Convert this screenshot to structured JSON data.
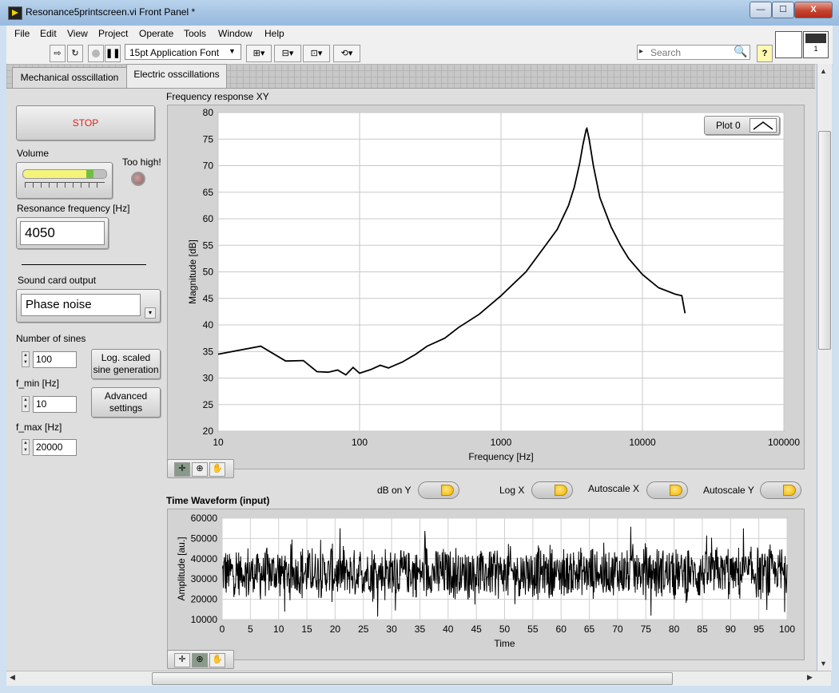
{
  "window": {
    "title": "Resonance5printscreen.vi Front Panel *",
    "controls": [
      "—",
      "☐",
      "X"
    ]
  },
  "menu": [
    "File",
    "Edit",
    "View",
    "Project",
    "Operate",
    "Tools",
    "Window",
    "Help"
  ],
  "toolbar": {
    "font_selector": "15pt Application Font",
    "search_placeholder": "Search",
    "help": "?"
  },
  "connector": {
    "index": "1"
  },
  "tabs": [
    {
      "label": "Mechanical osscillation",
      "active": false
    },
    {
      "label": "Electric osscillations",
      "active": true
    }
  ],
  "controls": {
    "stop_label": "STOP",
    "volume_label": "Volume",
    "volume_level": 0.85,
    "too_high_label": "Too high!",
    "resonance_label": "Resonance frequency [Hz]",
    "resonance_value": "4050",
    "sound_card_label": "Sound card output",
    "sound_card_value": "Phase noise",
    "num_sines_label": "Number of sines",
    "num_sines_value": "100",
    "fmin_label": "f_min [Hz]",
    "fmin_value": "10",
    "fmax_label": "f_max [Hz]",
    "fmax_value": "20000",
    "log_scaled_label": "Log. scaled sine generation",
    "advanced_label": "Advanced settings"
  },
  "switches": [
    {
      "label": "dB on Y",
      "on": true
    },
    {
      "label": "Log X",
      "on": true
    },
    {
      "label": "Autoscale X",
      "on": true
    },
    {
      "label": "Autoscale Y",
      "on": true
    }
  ],
  "colors": {
    "stop_text": "#e02020",
    "plot_line": "#000000",
    "led_off": "#b08080",
    "volume_fill": "#f4f47a",
    "volume_tip": "#70c040"
  },
  "chart_data": [
    {
      "type": "line",
      "title": "Frequency response XY",
      "xlabel": "Frequency [Hz]",
      "ylabel": "Magnitude [dB]",
      "xscale": "log",
      "xlim": [
        10,
        100000
      ],
      "ylim": [
        20,
        80
      ],
      "xticks": [
        "10",
        "100",
        "1000",
        "10000",
        "100000"
      ],
      "yticks": [
        "20",
        "25",
        "30",
        "35",
        "40",
        "45",
        "50",
        "55",
        "60",
        "65",
        "70",
        "75",
        "80"
      ],
      "grid": true,
      "legend": "top-right",
      "series": [
        {
          "name": "Plot 0",
          "x": [
            10,
            20,
            30,
            40,
            50,
            60,
            70,
            80,
            90,
            100,
            120,
            140,
            160,
            180,
            200,
            250,
            300,
            400,
            500,
            700,
            1000,
            1500,
            2000,
            2500,
            3000,
            3300,
            3600,
            3800,
            4000,
            4050,
            4200,
            4500,
            5000,
            6000,
            7000,
            8000,
            10000,
            13000,
            17000,
            19000,
            20000
          ],
          "y": [
            34.5,
            36,
            33.2,
            33.3,
            31.2,
            31.1,
            31.5,
            30.6,
            32,
            30.9,
            31.6,
            32.4,
            31.9,
            32.5,
            33,
            34.5,
            36,
            37.5,
            39.5,
            42,
            45.5,
            50,
            54.5,
            58,
            62.5,
            66,
            70.5,
            74,
            76.8,
            77,
            75,
            70,
            64,
            58.5,
            55,
            52.5,
            49.5,
            47,
            45.8,
            45.5,
            42.2
          ]
        }
      ]
    },
    {
      "type": "line",
      "title": "Time Waveform (input)",
      "xlabel": "Time",
      "ylabel": "Amplitude [au.]",
      "xlim": [
        0,
        100
      ],
      "ylim": [
        10000,
        60000
      ],
      "xticks": [
        "0",
        "5",
        "10",
        "15",
        "20",
        "25",
        "30",
        "35",
        "40",
        "45",
        "50",
        "55",
        "60",
        "65",
        "70",
        "75",
        "80",
        "85",
        "90",
        "95",
        "100"
      ],
      "yticks": [
        "10000",
        "20000",
        "30000",
        "40000",
        "50000",
        "60000"
      ],
      "grid": true,
      "series": [
        {
          "description_level": "noise centered ~33000, range ~12000-58000",
          "center": 33000,
          "amplitude": 9000,
          "peak": 24000
        }
      ]
    }
  ]
}
